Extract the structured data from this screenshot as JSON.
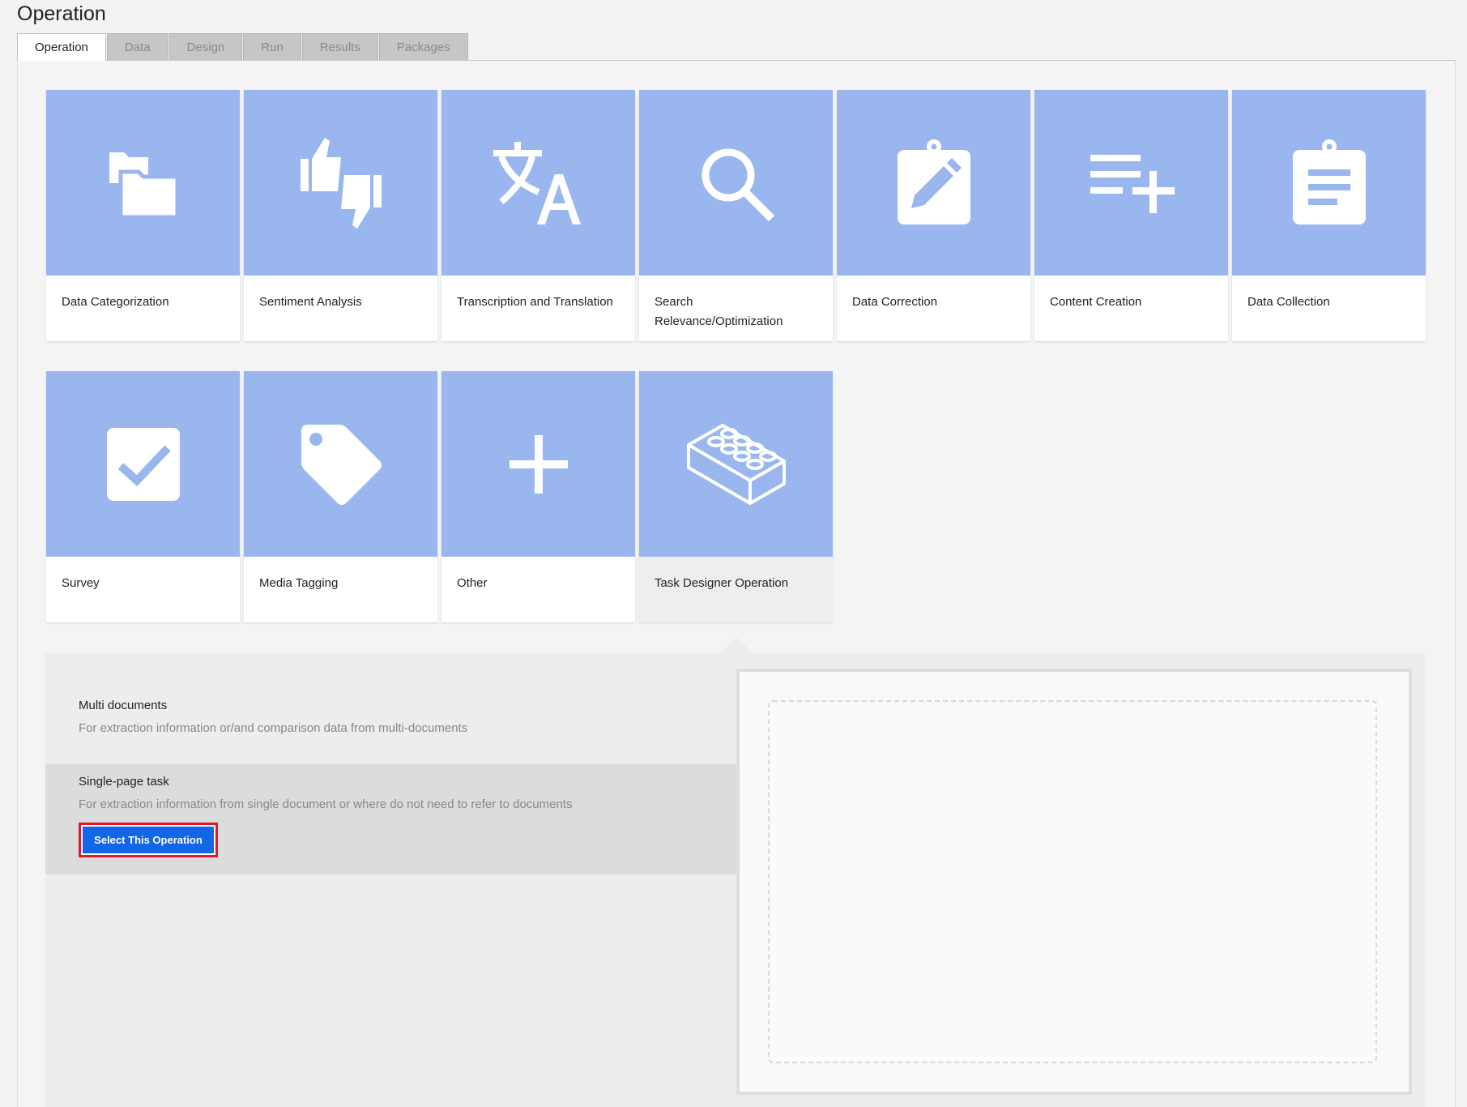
{
  "page": {
    "title": "Operation"
  },
  "tabs": [
    {
      "label": "Operation",
      "active": true
    },
    {
      "label": "Data",
      "active": false
    },
    {
      "label": "Design",
      "active": false
    },
    {
      "label": "Run",
      "active": false
    },
    {
      "label": "Results",
      "active": false
    },
    {
      "label": "Packages",
      "active": false
    }
  ],
  "operations": [
    {
      "label": "Data Categorization",
      "icon": "folders-icon"
    },
    {
      "label": "Sentiment Analysis",
      "icon": "thumbs-up-down-icon"
    },
    {
      "label": "Transcription and Translation",
      "icon": "translate-icon"
    },
    {
      "label": "Search Relevance/Optimization",
      "icon": "search-icon"
    },
    {
      "label": "Data Correction",
      "icon": "clipboard-edit-icon"
    },
    {
      "label": "Content Creation",
      "icon": "playlist-add-icon"
    },
    {
      "label": "Data Collection",
      "icon": "clipboard-list-icon"
    },
    {
      "label": "Survey",
      "icon": "checkbox-icon"
    },
    {
      "label": "Media Tagging",
      "icon": "tag-icon"
    },
    {
      "label": "Other",
      "icon": "plus-icon"
    },
    {
      "label": "Task Designer Operation",
      "icon": "lego-brick-icon",
      "selected": true
    }
  ],
  "details": {
    "options": [
      {
        "title": "Multi documents",
        "description": "For extraction information or/and comparison data from multi-documents"
      },
      {
        "title": "Single-page task",
        "description": "For extraction information from single document or where do not need to refer to documents"
      }
    ],
    "select_button": "Select This Operation"
  },
  "colors": {
    "tile": "#99b7ee",
    "button": "#1266e8",
    "highlight": "#e0182c"
  }
}
